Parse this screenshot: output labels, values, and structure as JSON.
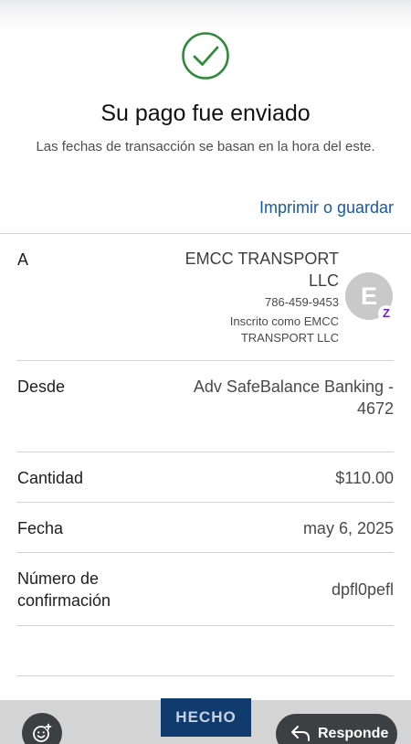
{
  "header": {
    "title": "Su pago fue enviado",
    "subtitle": "Las fechas de transacción se basan en la hora del este.",
    "print_link": "Imprimir o guardar"
  },
  "details": {
    "to": {
      "label": "A",
      "name": "EMCC TRANSPORT LLC",
      "phone": "786-459-9453",
      "enrolled_as": "Inscrito como EMCC TRANSPORT LLC",
      "avatar_letter": "E",
      "badge": "Z"
    },
    "from": {
      "label": "Desde",
      "value": "Adv SafeBalance Banking - 4672"
    },
    "amount": {
      "label": "Cantidad",
      "value": "$110.00"
    },
    "date": {
      "label": "Fecha",
      "value": "may 6, 2025"
    },
    "confirmation": {
      "label": "Número de confirmación",
      "value": "dpfl0pefl"
    }
  },
  "footer": {
    "done_label": "HECHO",
    "reply_label": "Responde",
    "emoji_icon": "add-emoji-icon",
    "reply_icon": "reply-arrow-icon"
  },
  "colors": {
    "success_green": "#2e8b3a",
    "link_blue": "#1a5aa0",
    "primary_button": "#0f3b6f",
    "zelle_purple": "#6d1ed4"
  }
}
